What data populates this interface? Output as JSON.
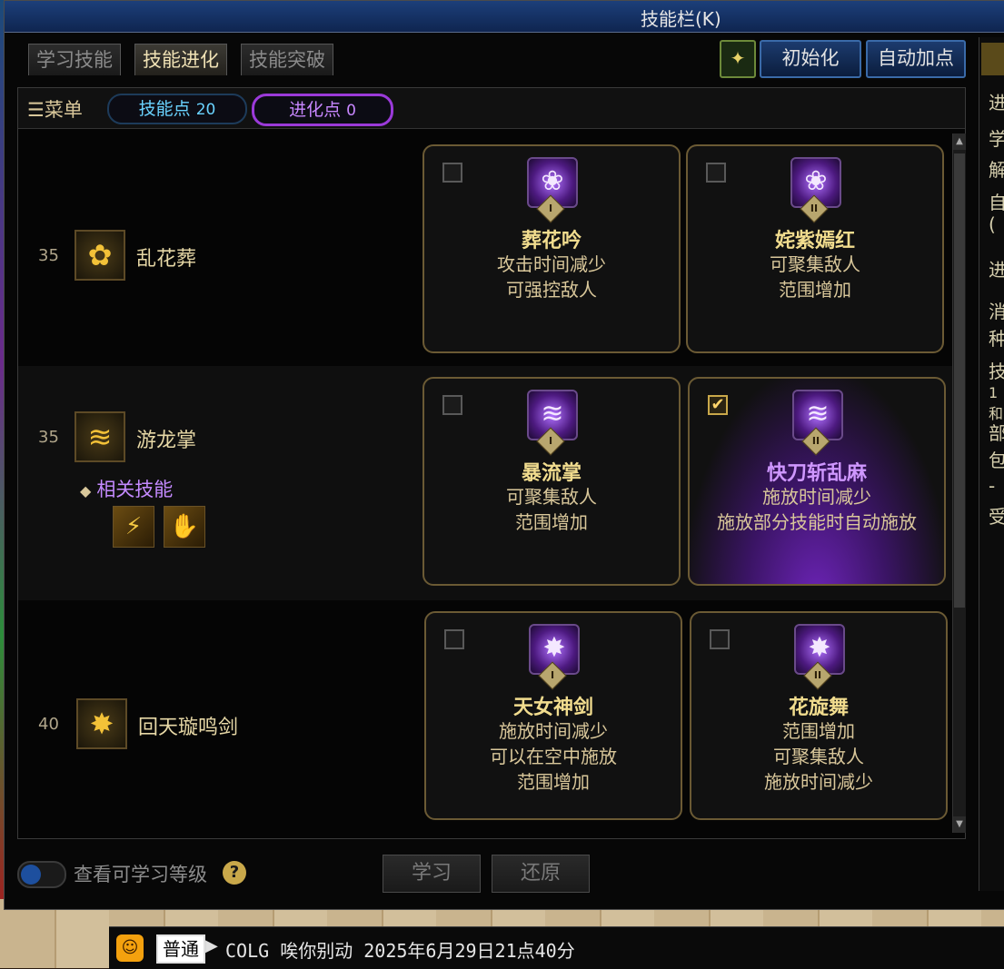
{
  "window": {
    "title": "技能栏(K)"
  },
  "tabs": [
    {
      "label": "学习技能",
      "active": false
    },
    {
      "label": "技能进化",
      "active": true
    },
    {
      "label": "技能突破",
      "active": false
    }
  ],
  "header_buttons": {
    "icon_label": "✦",
    "reset_label": "初始化",
    "auto_label": "自动加点"
  },
  "menubar": {
    "menu_label": "菜单",
    "skill_points_label": "技能点",
    "skill_points": "20",
    "evo_points_label": "进化点",
    "evo_points": "0"
  },
  "skills": [
    {
      "level": "35",
      "name": "乱花葬",
      "icon": "flower-icon",
      "evolutions": [
        {
          "name": "葬花吟",
          "tier": "I",
          "checked": false,
          "lines": [
            "攻击时间减少",
            "可强控敌人"
          ]
        },
        {
          "name": "姹紫嫣红",
          "tier": "II",
          "checked": false,
          "lines": [
            "可聚集敌人",
            "范围增加"
          ]
        }
      ]
    },
    {
      "level": "35",
      "name": "游龙掌",
      "icon": "dragon-palm-icon",
      "related_label": "相关技能",
      "evolutions": [
        {
          "name": "暴流掌",
          "tier": "I",
          "checked": false,
          "lines": [
            "可聚集敌人",
            "范围增加"
          ]
        },
        {
          "name": "快刀斩乱麻",
          "tier": "II",
          "checked": true,
          "lines": [
            "施放时间减少",
            "施放部分技能时自动施放"
          ]
        }
      ]
    },
    {
      "level": "40",
      "name": "回天璇鸣剑",
      "icon": "sword-burst-icon",
      "evolutions": [
        {
          "name": "天女神剑",
          "tier": "I",
          "checked": false,
          "lines": [
            "施放时间减少",
            "可以在空中施放",
            "范围增加"
          ]
        },
        {
          "name": "花旋舞",
          "tier": "II",
          "checked": false,
          "lines": [
            "范围增加",
            "可聚集敌人",
            "施放时间减少"
          ]
        }
      ]
    }
  ],
  "footer": {
    "toggle_label": "查看可学习等级",
    "help": "?",
    "learn_label": "学习",
    "restore_label": "还原"
  },
  "side_panel": {
    "chars": [
      "进",
      "学",
      "解",
      "自",
      "(",
      "进",
      "消",
      "种",
      "技",
      "1和",
      "部",
      "包",
      "-",
      "受"
    ]
  },
  "chat": {
    "mode": "普通",
    "message": "COLG 唉你别动 2025年6月29日21点40分"
  },
  "colors": {
    "accent_blue": "#6ad3ff",
    "accent_purple": "#c887ff",
    "gold": "#f1dc8e"
  }
}
